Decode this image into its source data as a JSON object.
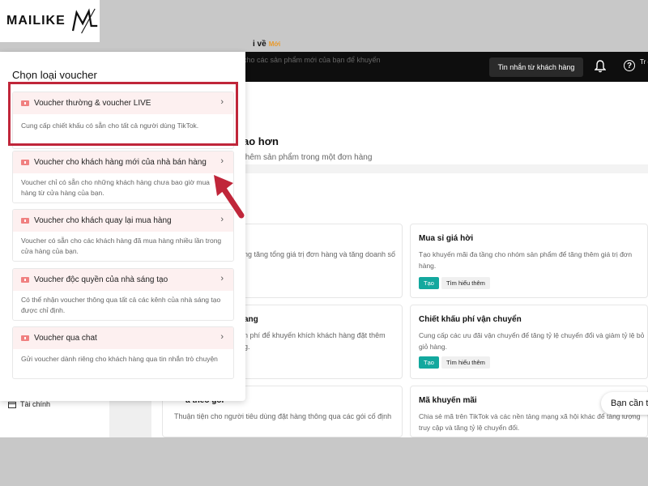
{
  "logo": {
    "text": "MAILIKE",
    "mark": "ML"
  },
  "topbar": {
    "customer_messages": "Tin nhắn từ khách hàng",
    "bell_icon": "bell-icon",
    "help_icon": "help-icon",
    "truncated_label": "Tr gi"
  },
  "sidebar": {
    "finance": "Tài chính"
  },
  "background_top": {
    "title_partial": "i về",
    "new_badge": "Mới",
    "desc_partial": "cho các sản phẩm mới của bạn để khuyến"
  },
  "section": {
    "title_partial": "ao hơn",
    "subtitle_partial": "thêm sản phẩm trong một đơn hàng"
  },
  "cards": [
    {
      "title": "Mua sỉ giá hời",
      "desc": "Tạo khuyến mãi đa tầng cho nhóm sản phẩm để tăng thêm giá trị đơn hàng.",
      "create": "Tạo",
      "learn": "Tìm hiểu thêm"
    },
    {
      "title": "Chiết khấu phí vận chuyển",
      "desc": "Cung cấp các ưu đãi vận chuyển để tăng tỷ lệ chuyển đổi và giảm tỷ lệ bỏ giỏ hàng.",
      "create": "Tạo",
      "learn": "Tìm hiểu thêm"
    },
    {
      "title": "Mã khuyến mãi",
      "desc": "Chia sẻ mã trên TikTok và các nền tảng mạng xã hội khác để tăng lượng truy cập và tăng tỷ lệ chuyển đổi."
    }
  ],
  "left_cards_partial": {
    "c1": "ng tăng tổng giá trị đơn hàng và tăng doanh số",
    "c2_title": "ang",
    "c2_desc": "n phí để khuyến khích khách hàng đặt thêm g.",
    "c3_title": "a theo gói",
    "c3_desc": "Thuận tiện cho người tiêu dùng đặt hàng thông qua các gói cố định"
  },
  "chat_button": "Bạn cần t",
  "modal": {
    "title": "Chọn loại voucher",
    "options": [
      {
        "label": "Voucher thường & voucher LIVE",
        "desc": "Cung cấp chiết khấu có sẵn cho tất cả người dùng TikTok."
      },
      {
        "label": "Voucher cho khách hàng mới của nhà bán hàng",
        "desc": "Voucher chỉ có sẵn cho những khách hàng chưa bao giờ mua hàng từ cửa hàng của bạn."
      },
      {
        "label": "Voucher cho khách quay lại mua hàng",
        "desc": "Voucher có sẵn cho các khách hàng đã mua hàng nhiều lần trong cửa hàng của bạn."
      },
      {
        "label": "Voucher độc quyền của nhà sáng tạo",
        "desc": "Có thể nhận voucher thông qua tất cả các kênh của nhà sáng tạo được chỉ định."
      },
      {
        "label": "Voucher qua chat",
        "desc": "Gửi voucher dành riêng cho khách hàng qua tin nhắn trò chuyện"
      }
    ]
  },
  "colors": {
    "highlight": "#c0263a",
    "teal": "#13a89e",
    "voucher_head": "#fdf0f0"
  }
}
